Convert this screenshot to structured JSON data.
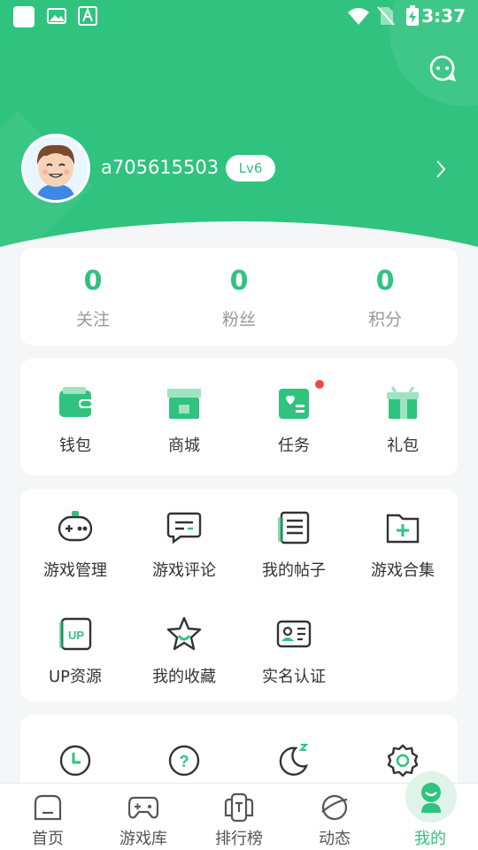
{
  "colors": {
    "accent": "#2fc37f",
    "badge_dot": "#f04848"
  },
  "status_bar": {
    "time": "3:37",
    "icons": [
      "app-icon",
      "image-icon",
      "font-icon",
      "wifi-icon",
      "no-sim-icon",
      "battery-charging-icon"
    ]
  },
  "profile": {
    "username": "a705615503",
    "level": "Lv6"
  },
  "stats": [
    {
      "value": "0",
      "label": "关注"
    },
    {
      "value": "0",
      "label": "粉丝"
    },
    {
      "value": "0",
      "label": "积分"
    }
  ],
  "wallet_row": [
    {
      "label": "钱包",
      "icon": "wallet-icon"
    },
    {
      "label": "商城",
      "icon": "shop-icon"
    },
    {
      "label": "任务",
      "icon": "task-icon",
      "has_badge": true
    },
    {
      "label": "礼包",
      "icon": "gift-icon"
    }
  ],
  "tools": [
    {
      "label": "游戏管理",
      "icon": "gamepad-icon"
    },
    {
      "label": "游戏评论",
      "icon": "comment-icon"
    },
    {
      "label": "我的帖子",
      "icon": "post-icon"
    },
    {
      "label": "游戏合集",
      "icon": "folder-add-icon"
    },
    {
      "label": "UP资源",
      "icon": "up-resource-icon"
    },
    {
      "label": "我的收藏",
      "icon": "star-icon"
    },
    {
      "label": "实名认证",
      "icon": "id-card-icon"
    }
  ],
  "more_icons": [
    "clock-icon",
    "help-icon",
    "night-mode-icon",
    "settings-icon"
  ],
  "tabbar": [
    {
      "label": "首页",
      "icon": "home-icon"
    },
    {
      "label": "游戏库",
      "icon": "game-library-icon"
    },
    {
      "label": "排行榜",
      "icon": "ranking-icon"
    },
    {
      "label": "动态",
      "icon": "planet-icon"
    },
    {
      "label": "我的",
      "icon": "mine-icon",
      "active": true
    }
  ]
}
